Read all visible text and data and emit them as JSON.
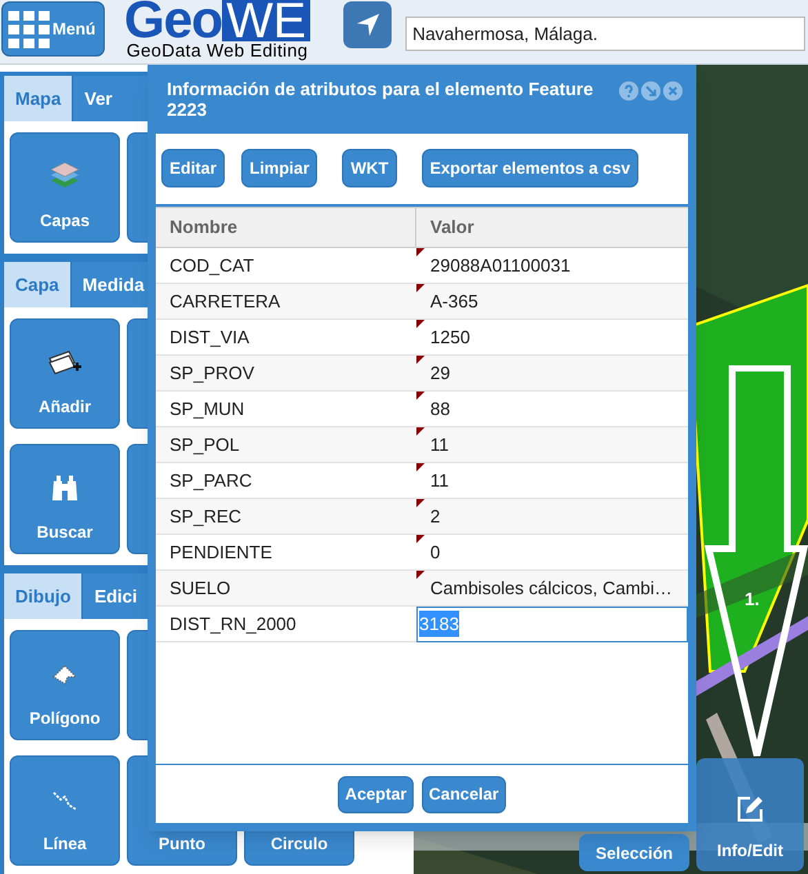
{
  "header": {
    "menu_label": "Menú",
    "logo_main": "Geo",
    "logo_box": "WE",
    "logo_subtitle": "GeoData Web Editing",
    "search": {
      "value": "Navahermosa, Málaga."
    }
  },
  "sidebar": [
    {
      "tabs": [
        {
          "label": "Mapa",
          "selected": true
        },
        {
          "label": "Ver",
          "selected": false
        }
      ],
      "rows": [
        [
          {
            "label": "Capas",
            "kind": "layers"
          }
        ]
      ]
    },
    {
      "tabs": [
        {
          "label": "Capa",
          "selected": true
        },
        {
          "label": "Medida",
          "selected": false
        }
      ],
      "rows": [
        [
          {
            "label": "Añadir",
            "kind": "add"
          }
        ],
        [
          {
            "label": "Buscar",
            "kind": "binoculars"
          }
        ]
      ]
    },
    {
      "tabs": [
        {
          "label": "Dibujo",
          "selected": true
        },
        {
          "label": "Edici",
          "selected": false
        }
      ],
      "rows": [
        [
          {
            "label": "Polígono",
            "kind": "polygon"
          }
        ],
        [
          {
            "label": "Línea",
            "kind": "line"
          },
          {
            "label": "Punto"
          },
          {
            "label": "Circulo"
          }
        ]
      ]
    }
  ],
  "dialog": {
    "title": "Información de atributos para el elemento Feature 2223",
    "toolbar": [
      "Editar",
      "Limpiar",
      "WKT",
      "Exportar elementos a csv"
    ],
    "columns": [
      "Nombre",
      "Valor"
    ],
    "rows": [
      {
        "name": "COD_CAT",
        "value": "29088A01100031",
        "modified": true,
        "editing": false
      },
      {
        "name": "CARRETERA",
        "value": "A-365",
        "modified": true,
        "editing": false
      },
      {
        "name": "DIST_VIA",
        "value": "1250",
        "modified": true,
        "editing": false
      },
      {
        "name": "SP_PROV",
        "value": "29",
        "modified": true,
        "editing": false
      },
      {
        "name": "SP_MUN",
        "value": "88",
        "modified": true,
        "editing": false
      },
      {
        "name": "SP_POL",
        "value": "11",
        "modified": true,
        "editing": false
      },
      {
        "name": "SP_PARC",
        "value": "11",
        "modified": true,
        "editing": false
      },
      {
        "name": "SP_REC",
        "value": "2",
        "modified": true,
        "editing": false
      },
      {
        "name": "PENDIENTE",
        "value": "0",
        "modified": true,
        "editing": false
      },
      {
        "name": "SUELO",
        "value": "Cambisoles cálcicos, Cambi…",
        "modified": true,
        "editing": false
      },
      {
        "name": "DIST_RN_2000",
        "value": "3183",
        "modified": false,
        "editing": true
      }
    ],
    "footer": [
      "Aceptar",
      "Cancelar"
    ]
  },
  "map": {
    "step_label": "1.",
    "buttons": [
      {
        "label": "Selección",
        "selected": false
      },
      {
        "label": "Info/Edit",
        "selected": true
      }
    ]
  }
}
